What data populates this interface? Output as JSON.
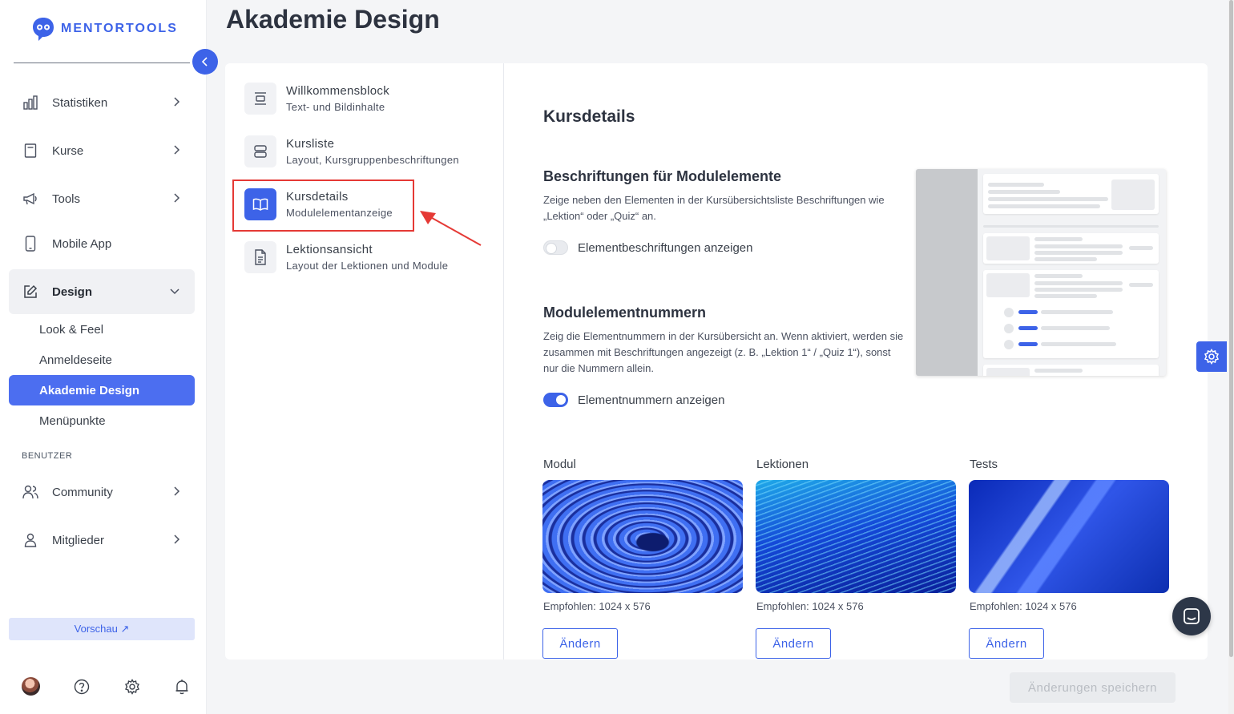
{
  "brand": {
    "name": "MENTORTOOLS",
    "accent": "#3d63e8"
  },
  "sidebar": {
    "items": [
      {
        "label": "Statistiken",
        "icon": "bar-chart-icon"
      },
      {
        "label": "Kurse",
        "icon": "book-icon"
      },
      {
        "label": "Tools",
        "icon": "megaphone-icon"
      },
      {
        "label": "Mobile App",
        "icon": "smartphone-icon"
      },
      {
        "label": "Design",
        "icon": "pen-edit-icon"
      }
    ],
    "design_sub": [
      "Look & Feel",
      "Anmeldeseite",
      "Akademie Design",
      "Menüpunkte"
    ],
    "section_users": "BENUTZER",
    "user_items": [
      {
        "label": "Community",
        "icon": "users-icon"
      },
      {
        "label": "Mitglieder",
        "icon": "user-icon"
      }
    ],
    "preview": "Vorschau ↗"
  },
  "page": {
    "title": "Akademie Design"
  },
  "settings_nav": [
    {
      "title": "Willkommensblock",
      "subtitle": "Text- und Bildinhalte"
    },
    {
      "title": "Kursliste",
      "subtitle": "Layout, Kursgruppenbeschriftungen"
    },
    {
      "title": "Kursdetails",
      "subtitle": "Modulelementanzeige"
    },
    {
      "title": "Lektionsansicht",
      "subtitle": "Layout der Lektionen und Module"
    }
  ],
  "content": {
    "heading": "Kursdetails",
    "labels_section": {
      "title": "Beschriftungen für Modulelemente",
      "description": "Zeige neben den Elementen in der Kursübersichtsliste Beschriftungen wie „Lektion“ oder „Quiz“ an.",
      "toggle_label": "Elementbeschriftungen anzeigen",
      "toggle_on": false
    },
    "numbers_section": {
      "title": "Modulelementnummern",
      "description": "Zeig die Elementnummern in der Kursübersicht an. Wenn aktiviert, werden sie zusammen mit Beschriftungen angezeigt (z. B. „Lektion 1“ / „Quiz 1“), sonst nur die Nummern allein.",
      "toggle_label": "Elementnummern anzeigen",
      "toggle_on": true
    },
    "images": [
      {
        "label": "Modul",
        "recommended": "Empfohlen: 1024 x 576",
        "button": "Ändern"
      },
      {
        "label": "Lektionen",
        "recommended": "Empfohlen: 1024 x 576",
        "button": "Ändern"
      },
      {
        "label": "Tests",
        "recommended": "Empfohlen: 1024 x 576",
        "button": "Ändern"
      }
    ]
  },
  "footer": {
    "save": "Änderungen speichern"
  }
}
